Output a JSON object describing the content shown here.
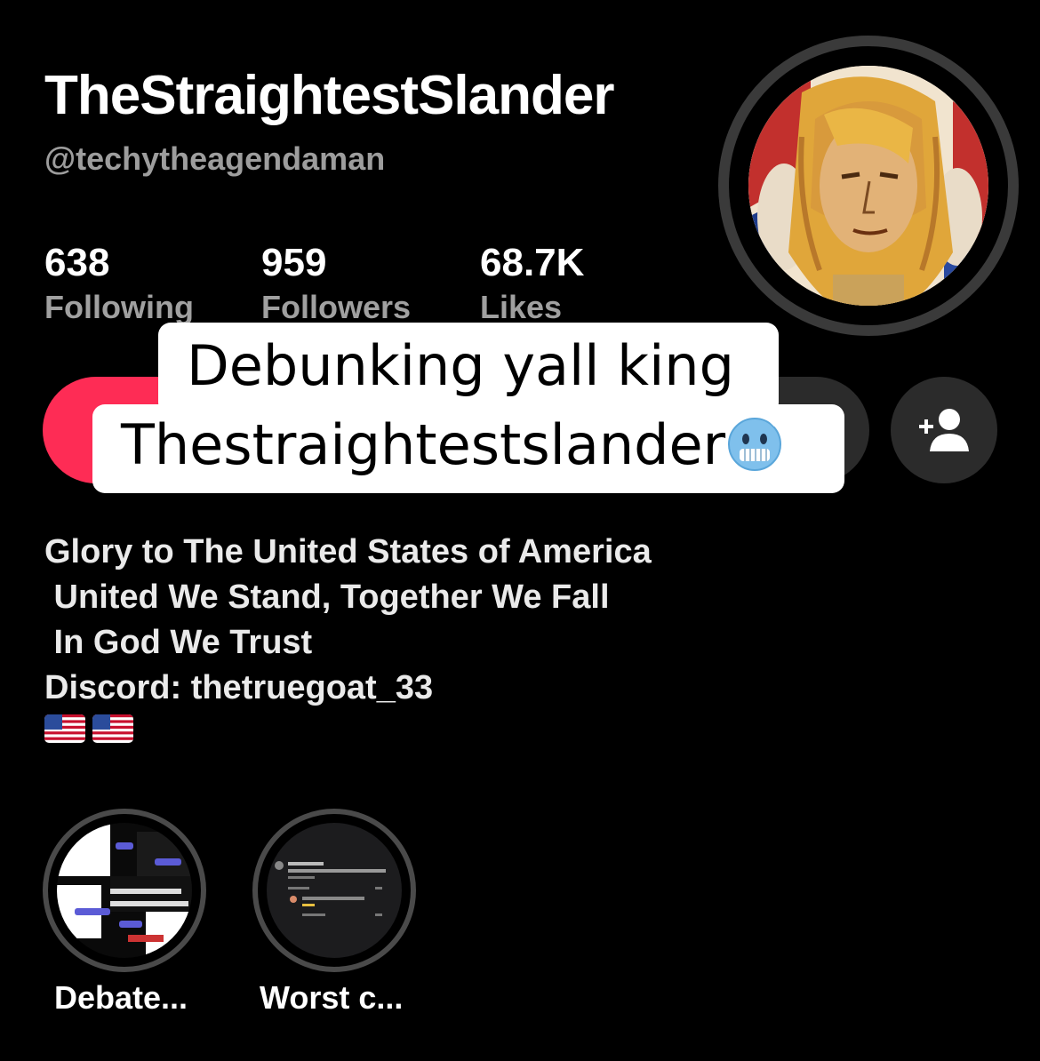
{
  "profile": {
    "display_name": "TheStraightestSlander",
    "handle": "@techytheagendaman"
  },
  "stats": {
    "following": {
      "value": "638",
      "label": "Following"
    },
    "followers": {
      "value": "959",
      "label": "Followers"
    },
    "likes": {
      "value": "68.7K",
      "label": "Likes"
    }
  },
  "caption": {
    "line1": "Debunking yall king",
    "line2": "Thestraightestslander"
  },
  "bio": {
    "line1": "Glory to The United States of America",
    "line2": " United We Stand, Together We Fall",
    "line3": " In God We Trust",
    "line4": "Discord: thetruegoat_33"
  },
  "highlights": [
    {
      "title": "Debate..."
    },
    {
      "title": "Worst c..."
    }
  ],
  "icons": {
    "add_friend": "add-friend-icon",
    "flag": "us-flag-icon",
    "caption_emoji": "cold-face-emoji-icon"
  },
  "colors": {
    "primary_button": "#fe2c55",
    "secondary_button": "#2b2b2b",
    "background": "#000000"
  }
}
